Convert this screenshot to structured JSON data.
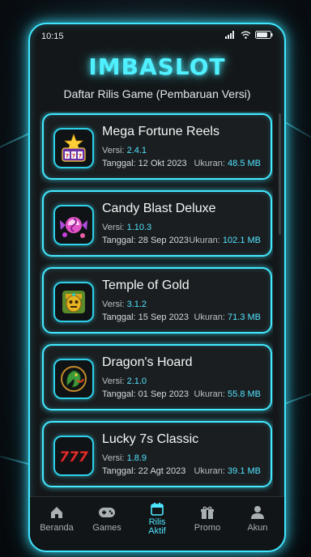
{
  "status": {
    "time": "10:15"
  },
  "header": {
    "title": "IMBASLOT",
    "subtitle": "Daftar Rilis Game (Pembaruan Versi)"
  },
  "labels": {
    "version": "Versi:",
    "date": "Tanggal:",
    "size": "Ukuran:"
  },
  "games": [
    {
      "name": "Mega Fortune Reels",
      "version": "2.4.1",
      "date": "12 Okt 2023",
      "size": "48.5 MB",
      "icon": "slot-machine-icon"
    },
    {
      "name": "Candy Blast Deluxe",
      "version": "1.10.3",
      "date": "28 Sep 2023",
      "size": "102.1 MB",
      "icon": "candy-icon"
    },
    {
      "name": "Temple of Gold",
      "version": "3.1.2",
      "date": "15 Sep 2023",
      "size": "71.3 MB",
      "icon": "golden-idol-icon"
    },
    {
      "name": "Dragon's Hoard",
      "version": "2.1.0",
      "date": "01 Sep 2023",
      "size": "55.8 MB",
      "icon": "dragon-icon"
    },
    {
      "name": "Lucky 7s Classic",
      "version": "1.8.9",
      "date": "22 Agt 2023",
      "size": "39.1 MB",
      "icon": "lucky-seven-icon"
    }
  ],
  "nav": [
    {
      "label": "Beranda",
      "icon": "home-icon"
    },
    {
      "label": "Games",
      "icon": "gamepad-icon"
    },
    {
      "label": "Rilis",
      "label2": "Aktif",
      "icon": "calendar-icon",
      "active": true
    },
    {
      "label": "Promo",
      "icon": "gift-icon"
    },
    {
      "label": "Akun",
      "icon": "user-icon"
    }
  ],
  "colors": {
    "accent": "#4fe6ff",
    "card_bg": "#1a1e20",
    "background": "#0b1217"
  }
}
